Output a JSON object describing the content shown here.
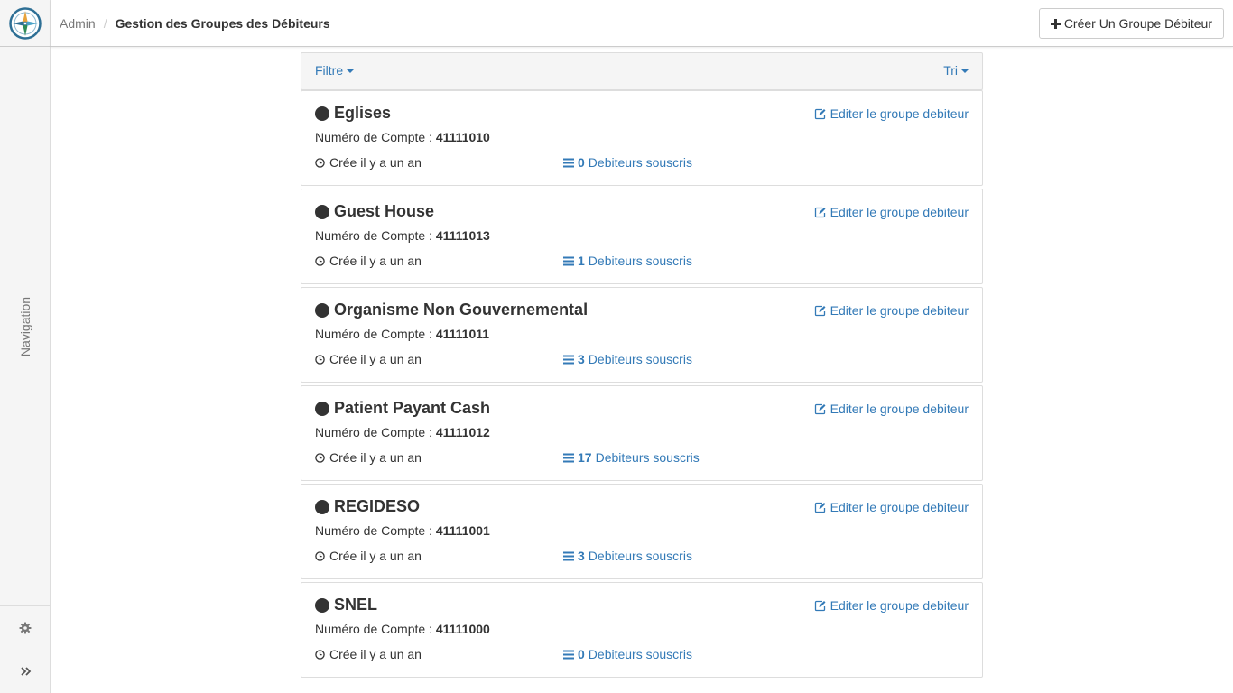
{
  "sidebar": {
    "navigation_label": "Navigation",
    "icons": [
      "logo-compass-icon",
      "gear-icon",
      "double-chevron-right-icon"
    ]
  },
  "header": {
    "breadcrumb_root": "Admin",
    "breadcrumb_separator": "/",
    "page_title": "Gestion des Groupes des Débiteurs",
    "create_button_label": "Créer Un Groupe Débiteur"
  },
  "toolbar": {
    "filter_label": "Filtre",
    "sort_label": "Tri"
  },
  "labels": {
    "account_prefix": "Numéro de Compte :",
    "created_text": "Crée il y a un an",
    "debtors_suffix": "Debiteurs souscris",
    "edit_label": "Editer le groupe debiteur"
  },
  "groups": [
    {
      "name": "Eglises",
      "account": "41111010",
      "count": "0"
    },
    {
      "name": "Guest House",
      "account": "41111013",
      "count": "1"
    },
    {
      "name": "Organisme Non Gouvernemental",
      "account": "41111011",
      "count": "3"
    },
    {
      "name": "Patient Payant Cash",
      "account": "41111012",
      "count": "17"
    },
    {
      "name": "REGIDESO",
      "account": "41111001",
      "count": "3"
    },
    {
      "name": "SNEL",
      "account": "41111000",
      "count": "0"
    }
  ],
  "colors": {
    "link": "#337ab7",
    "text": "#333333",
    "sidebar_bg": "#f5f5f5",
    "border": "#dddddd"
  }
}
